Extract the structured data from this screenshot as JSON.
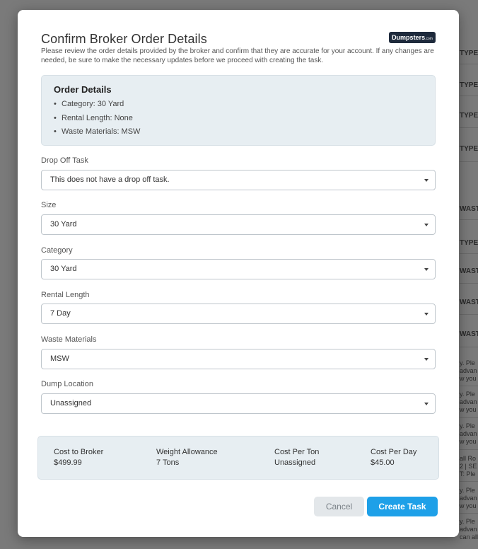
{
  "background": {
    "rows": [
      {
        "text": "TYPE",
        "style": "bold"
      },
      {
        "text": "TYPE",
        "style": "bold"
      },
      {
        "text": "TYPE",
        "style": "bold"
      },
      {
        "text": "TYPE",
        "style": "bold"
      },
      {
        "text": "WASTE",
        "style": "bold"
      },
      {
        "text": "TYPE",
        "style": "bold"
      },
      {
        "text": "WASTE",
        "style": "bold"
      },
      {
        "text": "WASTE",
        "style": "bold"
      },
      {
        "text": "WASTE",
        "style": "bold"
      },
      {
        "text": "y. Ple",
        "style": "small"
      },
      {
        "text": "advan",
        "style": "small"
      },
      {
        "text": "w you",
        "style": "small"
      },
      {
        "text": "y. Ple",
        "style": "small"
      },
      {
        "text": "advan",
        "style": "small"
      },
      {
        "text": "w you",
        "style": "small"
      },
      {
        "text": "y. Ple",
        "style": "small"
      },
      {
        "text": "advan",
        "style": "small"
      },
      {
        "text": "w you",
        "style": "small"
      },
      {
        "text": "all Ro",
        "style": "small"
      },
      {
        "text": "2 | SE",
        "style": "small"
      },
      {
        "text": "T: Ple",
        "style": "small"
      },
      {
        "text": "y. Ple",
        "style": "small"
      },
      {
        "text": "advan",
        "style": "small"
      },
      {
        "text": "w you",
        "style": "small"
      },
      {
        "text": "y. Ple",
        "style": "small"
      },
      {
        "text": "advan",
        "style": "small"
      },
      {
        "text": "can allow you",
        "style": "small"
      }
    ]
  },
  "modal": {
    "title": "Confirm Broker Order Details",
    "logo_text": "Dumpsters",
    "logo_suffix": ".com",
    "intro": "Please review the order details provided by the broker and confirm that they are accurate for your account. If any changes are needed, be sure to make the necessary updates before we proceed with creating the task.",
    "order_details": {
      "heading": "Order Details",
      "items": [
        "Category: 30 Yard",
        "Rental Length: None",
        "Waste Materials: MSW"
      ]
    },
    "fields": {
      "drop_off": {
        "label": "Drop Off Task",
        "value": "This does not have a drop off task."
      },
      "size": {
        "label": "Size",
        "value": "30 Yard"
      },
      "category": {
        "label": "Category",
        "value": "30 Yard"
      },
      "rental_length": {
        "label": "Rental Length",
        "value": "7 Day"
      },
      "waste_materials": {
        "label": "Waste Materials",
        "value": "MSW"
      },
      "dump_location": {
        "label": "Dump Location",
        "value": "Unassigned"
      }
    },
    "costs": {
      "cost_to_broker": {
        "label": "Cost to Broker",
        "value": "$499.99"
      },
      "weight_allowance": {
        "label": "Weight Allowance",
        "value": "7 Tons"
      },
      "cost_per_ton": {
        "label": "Cost Per Ton",
        "value": "Unassigned"
      },
      "cost_per_day": {
        "label": "Cost Per Day",
        "value": "$45.00"
      }
    },
    "buttons": {
      "cancel": "Cancel",
      "create": "Create Task"
    }
  },
  "colors": {
    "primary": "#1ea0e8",
    "panel": "#e7eef2",
    "overlay": "#7a7a7a"
  }
}
